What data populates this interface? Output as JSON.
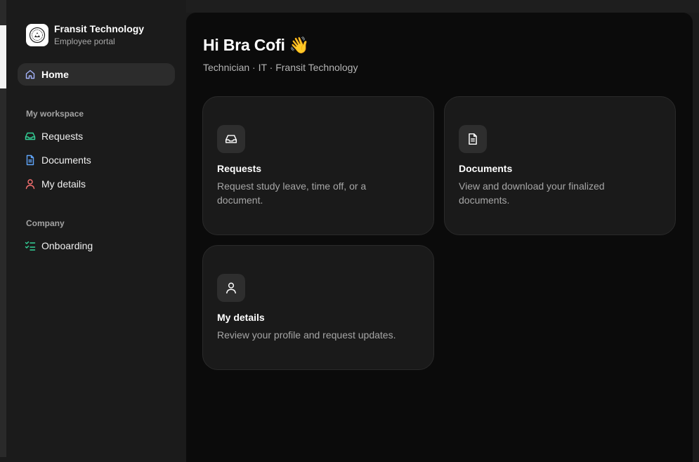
{
  "brand": {
    "name": "Fransit Technology",
    "subtitle": "Employee portal"
  },
  "sidebar": {
    "home_label": "Home",
    "sections": [
      {
        "label": "My workspace",
        "items": [
          {
            "label": "Requests",
            "icon": "inbox-icon",
            "color": "#34d399"
          },
          {
            "label": "Documents",
            "icon": "document-icon",
            "color": "#60a5fa"
          },
          {
            "label": "My details",
            "icon": "user-icon",
            "color": "#f87171"
          }
        ]
      },
      {
        "label": "Company",
        "items": [
          {
            "label": "Onboarding",
            "icon": "checklist-icon",
            "color": "#34d399"
          }
        ]
      }
    ]
  },
  "main": {
    "greeting": "Hi Bra Cofi 👋",
    "role_line": "Technician · IT · Fransit Technology",
    "cards": [
      {
        "title": "Requests",
        "description": "Request study leave, time off, or a document.",
        "icon": "inbox-icon"
      },
      {
        "title": "Documents",
        "description": "View and download your finalized documents.",
        "icon": "document-icon"
      },
      {
        "title": "My details",
        "description": "Review your profile and request updates.",
        "icon": "user-icon"
      }
    ]
  },
  "colors": {
    "sidebar_bg": "#1b1b1b",
    "main_bg": "#0b0b0b",
    "card_bg": "#1a1a1a",
    "home_icon": "#a5b4fc"
  }
}
